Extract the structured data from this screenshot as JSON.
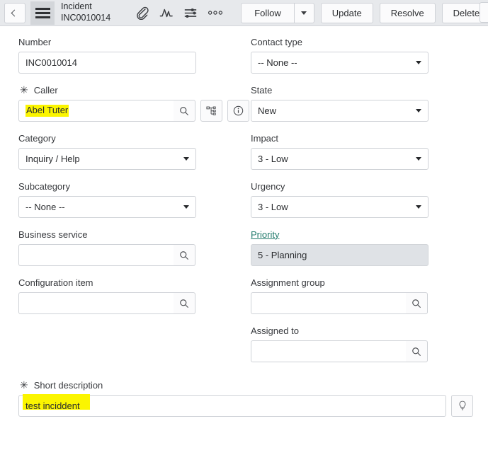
{
  "header": {
    "back_icon": "chevron-left-icon",
    "menu_icon": "hamburger-menu-icon",
    "title": "Incident",
    "record_number": "INC0010014",
    "icons": [
      {
        "name": "attachment-paperclip-icon",
        "label": "Attachments"
      },
      {
        "name": "activity-stream-icon",
        "label": "Activity stream"
      },
      {
        "name": "personalize-form-sliders-icon",
        "label": "Personalize form"
      },
      {
        "name": "more-options-ellipsis-icon",
        "label": "More options"
      }
    ],
    "buttons": {
      "follow": "Follow",
      "follow_caret_icon": "chevron-down-icon",
      "update": "Update",
      "resolve": "Resolve",
      "delete": "Delete"
    }
  },
  "colors": {
    "header_bg": "#e7e9ec",
    "link_teal": "#1f7a6b",
    "highlight_yellow": "#fbf500",
    "readonly_bg": "#dfe2e6",
    "border": "#cfd2d7"
  },
  "form": {
    "left": [
      {
        "label": "Number",
        "required": false,
        "type": "text",
        "value": "INC0010014",
        "highlighted": false
      },
      {
        "label": "Caller",
        "required": true,
        "type": "reference",
        "value": "Abel Tuter",
        "highlighted": true,
        "buttons": [
          "search-magnifier-icon",
          "org-chart-hierarchy-icon",
          "info-circle-icon"
        ]
      },
      {
        "label": "Category",
        "required": false,
        "type": "select",
        "value": "Inquiry / Help",
        "highlighted": false
      },
      {
        "label": "Subcategory",
        "required": false,
        "type": "select",
        "value": "-- None --",
        "highlighted": false
      },
      {
        "label": "Business service",
        "required": false,
        "type": "reference",
        "value": "",
        "highlighted": false,
        "buttons": [
          "search-magnifier-icon"
        ]
      },
      {
        "label": "Configuration item",
        "required": false,
        "type": "reference",
        "value": "",
        "highlighted": false,
        "buttons": [
          "search-magnifier-icon"
        ]
      }
    ],
    "right": [
      {
        "label": "Contact type",
        "required": false,
        "type": "select",
        "value": "-- None --",
        "is_link_label": false
      },
      {
        "label": "State",
        "required": false,
        "type": "select",
        "value": "New",
        "is_link_label": false
      },
      {
        "label": "Impact",
        "required": false,
        "type": "select",
        "value": "3 - Low",
        "is_link_label": false
      },
      {
        "label": "Urgency",
        "required": false,
        "type": "select",
        "value": "3 - Low",
        "is_link_label": false
      },
      {
        "label": "Priority",
        "required": false,
        "type": "readonly",
        "value": "5 - Planning",
        "is_link_label": true
      },
      {
        "label": "Assignment group",
        "required": false,
        "type": "reference",
        "value": "",
        "is_link_label": false,
        "buttons": [
          "search-magnifier-icon"
        ]
      },
      {
        "label": "Assigned to",
        "required": false,
        "type": "reference",
        "value": "",
        "is_link_label": false,
        "buttons": [
          "search-magnifier-icon"
        ]
      }
    ],
    "bottom": {
      "label": "Short description",
      "required": true,
      "value": "test inciddent",
      "highlighted": true,
      "button_icon": "lightbulb-suggestion-icon"
    },
    "required_marker": "✳"
  }
}
